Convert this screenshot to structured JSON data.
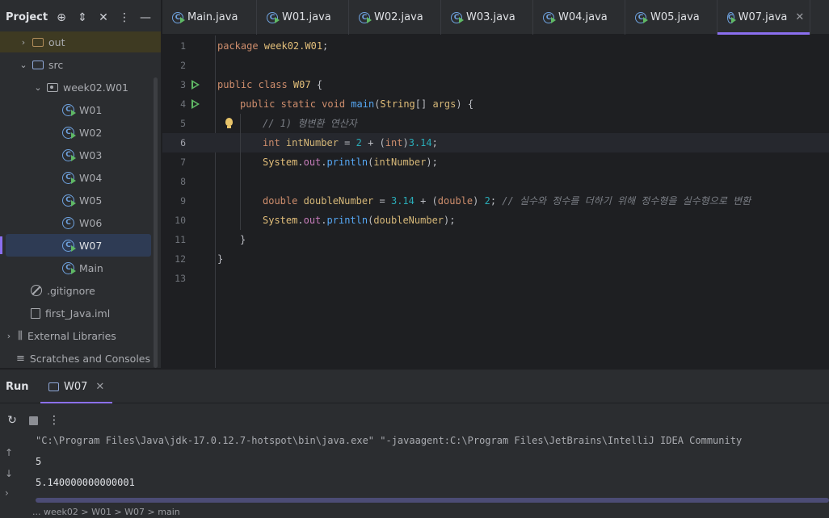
{
  "project_panel": {
    "title": "Project",
    "tree": [
      {
        "label": "out",
        "type": "folder-excluded"
      },
      {
        "label": "src",
        "type": "folder"
      },
      {
        "label": "week02.W01",
        "type": "package"
      },
      {
        "label": "W01",
        "type": "class-run"
      },
      {
        "label": "W02",
        "type": "class-run"
      },
      {
        "label": "W03",
        "type": "class-run"
      },
      {
        "label": "W04",
        "type": "class-run"
      },
      {
        "label": "W05",
        "type": "class-run"
      },
      {
        "label": "W06",
        "type": "class"
      },
      {
        "label": "W07",
        "type": "class-run",
        "selected": true
      },
      {
        "label": "Main",
        "type": "class-run"
      },
      {
        "label": ".gitignore",
        "type": "gitignore"
      },
      {
        "label": "first_Java.iml",
        "type": "iml"
      },
      {
        "label": "External Libraries",
        "type": "library"
      },
      {
        "label": "Scratches and Consoles",
        "type": "scratches"
      }
    ]
  },
  "tabs": [
    {
      "label": "Main.java",
      "active": false
    },
    {
      "label": "W01.java",
      "active": false
    },
    {
      "label": "W02.java",
      "active": false
    },
    {
      "label": "W03.java",
      "active": false
    },
    {
      "label": "W04.java",
      "active": false
    },
    {
      "label": "W05.java",
      "active": false
    },
    {
      "label": "W07.java",
      "active": true
    }
  ],
  "editor": {
    "current_line": 6,
    "lines": [
      {
        "n": "1",
        "tokens": [
          [
            "kw",
            "package "
          ],
          [
            "cls",
            "week02.W01"
          ],
          [
            "par",
            ";"
          ]
        ]
      },
      {
        "n": "2",
        "tokens": []
      },
      {
        "n": "3",
        "run": true,
        "tokens": [
          [
            "kw",
            "public class "
          ],
          [
            "cls",
            "W07"
          ],
          [
            "par",
            " {"
          ]
        ]
      },
      {
        "n": "4",
        "run": true,
        "indent": 1,
        "tokens": [
          [
            "kw",
            "public static void "
          ],
          [
            "fn",
            "main"
          ],
          [
            "par",
            "("
          ],
          [
            "cls",
            "String"
          ],
          [
            "par",
            "[] "
          ],
          [
            "var",
            "args"
          ],
          [
            "par",
            ") {"
          ]
        ]
      },
      {
        "n": "5",
        "bulb": true,
        "indent": 2,
        "tokens": [
          [
            "cmt",
            "// 1) 형변환 연산자"
          ]
        ]
      },
      {
        "n": "6",
        "indent": 2,
        "tokens": [
          [
            "kw",
            "int "
          ],
          [
            "var",
            "intNumber"
          ],
          [
            "par",
            " = "
          ],
          [
            "num",
            "2"
          ],
          [
            "par",
            " + ("
          ],
          [
            "kw",
            "int"
          ],
          [
            "par",
            ")"
          ],
          [
            "num",
            "3.14"
          ],
          [
            "par",
            ";"
          ]
        ]
      },
      {
        "n": "7",
        "indent": 2,
        "tokens": [
          [
            "cls",
            "System"
          ],
          [
            "par",
            "."
          ],
          [
            "fld",
            "out"
          ],
          [
            "par",
            "."
          ],
          [
            "fn",
            "println"
          ],
          [
            "par",
            "("
          ],
          [
            "var",
            "intNumber"
          ],
          [
            "par",
            ");"
          ]
        ]
      },
      {
        "n": "8",
        "tokens": []
      },
      {
        "n": "9",
        "indent": 2,
        "tokens": [
          [
            "kw",
            "double "
          ],
          [
            "var",
            "doubleNumber"
          ],
          [
            "par",
            " = "
          ],
          [
            "num",
            "3.14"
          ],
          [
            "par",
            " + ("
          ],
          [
            "kw",
            "double"
          ],
          [
            "par",
            ") "
          ],
          [
            "num",
            "2"
          ],
          [
            "par",
            "; "
          ],
          [
            "cmt",
            "// 실수와 정수를 더하기 위해 정수형을 실수형으로 변환"
          ]
        ]
      },
      {
        "n": "10",
        "indent": 2,
        "tokens": [
          [
            "cls",
            "System"
          ],
          [
            "par",
            "."
          ],
          [
            "fld",
            "out"
          ],
          [
            "par",
            "."
          ],
          [
            "fn",
            "println"
          ],
          [
            "par",
            "("
          ],
          [
            "var",
            "doubleNumber"
          ],
          [
            "par",
            ");"
          ]
        ]
      },
      {
        "n": "11",
        "indent": 1,
        "tokens": [
          [
            "par",
            "}"
          ]
        ]
      },
      {
        "n": "12",
        "tokens": [
          [
            "par",
            "}"
          ]
        ]
      },
      {
        "n": "13",
        "tokens": []
      }
    ]
  },
  "run_panel": {
    "title": "Run",
    "tab_label": "W07",
    "command_line": "\"C:\\Program Files\\Java\\jdk-17.0.12.7-hotspot\\bin\\java.exe\" \"-javaagent:C:\\Program Files\\JetBrains\\IntelliJ IDEA Community",
    "output": [
      "5",
      "5.140000000000001"
    ]
  },
  "breadcrumbs": "... week02 > W01 > W07 > main"
}
